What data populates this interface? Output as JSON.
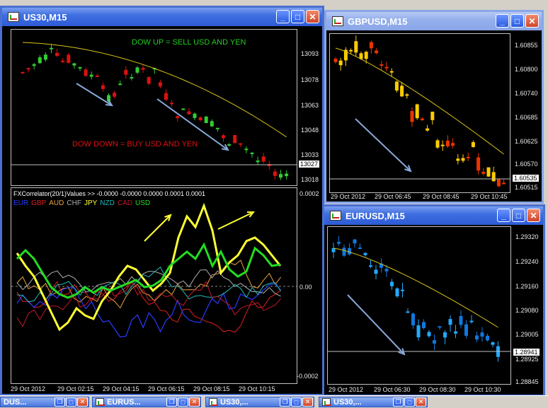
{
  "windows": {
    "us30": {
      "title": "US30,M15",
      "annotation_sell": "DOW UP = SELL USD AND YEN",
      "annotation_buy": "DOW DOWN = BUY USD AND YEN",
      "price_labels": [
        "13093",
        "13078",
        "13063",
        "13048",
        "13033",
        "13018"
      ],
      "current_price": "13027",
      "indicator_header": "FXCorrelator(20/1)Values >> -0.0000 -0.0000 0.0000 0.0001 0.0001",
      "legend": [
        {
          "name": "EUR",
          "color": "#2a3cff"
        },
        {
          "name": "GBP",
          "color": "#e02020"
        },
        {
          "name": "AUD",
          "color": "#e8a040"
        },
        {
          "name": "CHF",
          "color": "#b0b0b0"
        },
        {
          "name": "JPY",
          "color": "#ffff33"
        },
        {
          "name": "NZD",
          "color": "#22b8b8"
        },
        {
          "name": "CAD",
          "color": "#c0182b"
        },
        {
          "name": "USD",
          "color": "#22dd22"
        }
      ],
      "indicator_scale": [
        "0.0002",
        "0.00",
        "-0.0002"
      ],
      "time_labels": [
        "29 Oct 2012",
        "29 Oct 02:15",
        "29 Oct 04:15",
        "29 Oct 06:15",
        "29 Oct 08:15",
        "29 Oct 10:15"
      ]
    },
    "gbpusd": {
      "title": "GBPUSD,M15",
      "price_labels": [
        "1.60855",
        "1.60800",
        "1.60740",
        "1.60685",
        "1.60625",
        "1.60570",
        "1.60515"
      ],
      "current_price": "1.60535",
      "time_labels": [
        "29 Oct 2012",
        "29 Oct 06:45",
        "29 Oct 08:45",
        "29 Oct 10:45"
      ]
    },
    "eurusd": {
      "title": "EURUSD,M15",
      "price_labels": [
        "1.29320",
        "1.29240",
        "1.29160",
        "1.29080",
        "1.29005",
        "1.28925",
        "1.28845"
      ],
      "current_price": "1.28941",
      "time_labels": [
        "29 Oct 2012",
        "29 Oct 06:30",
        "29 Oct 08:30",
        "29 Oct 10:30"
      ]
    }
  },
  "taskbar": [
    {
      "title": "DUS..."
    },
    {
      "title": "EURUS..."
    },
    {
      "title": "US30,..."
    },
    {
      "title": "US30,..."
    }
  ],
  "colors": {
    "bull": "#33cc33",
    "bear": "#dd1111",
    "gbp_bull": "#ffcc00",
    "gbp_bear": "#ee3300",
    "eur_bull": "#22aaff",
    "eur_bear": "#1177dd",
    "ma": "#d8c21a"
  }
}
